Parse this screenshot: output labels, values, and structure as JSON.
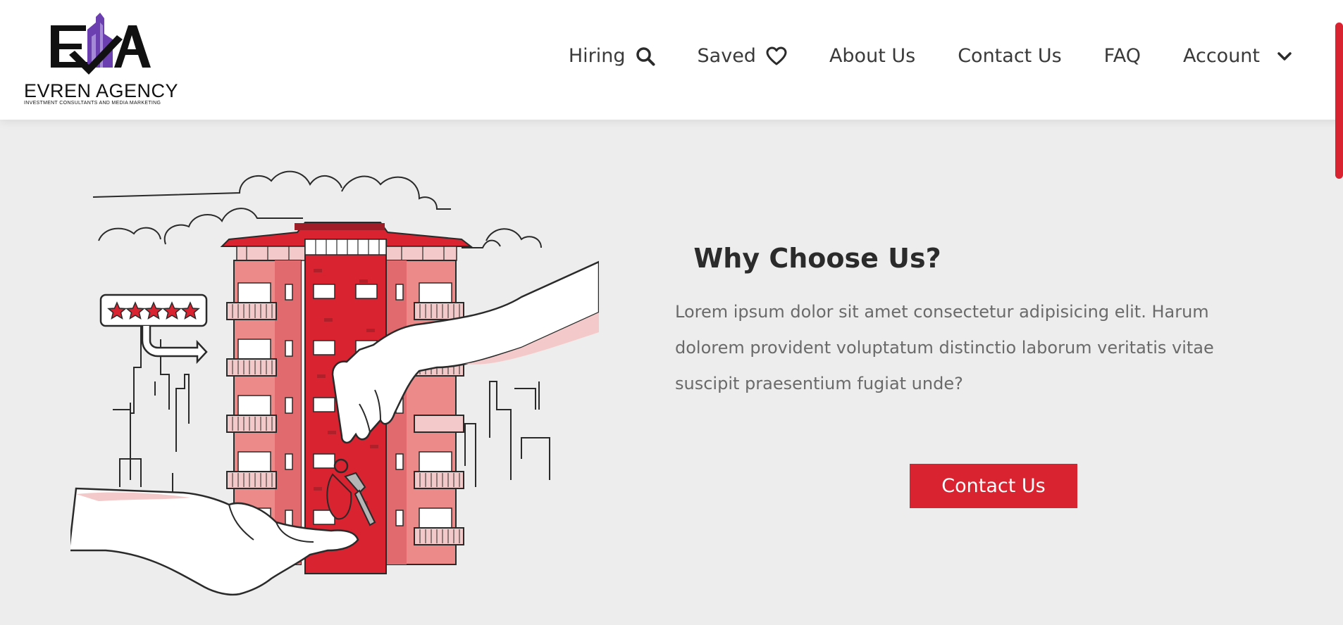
{
  "brand": {
    "name": "EVREN AGENCY",
    "tagline": "INVESTMENT CONSULTANTS AND MEDIA MARKETING",
    "monogram": "EA"
  },
  "nav": {
    "hiring": {
      "label": "Hiring",
      "icon": "search-icon"
    },
    "saved": {
      "label": "Saved",
      "icon": "heart-icon"
    },
    "about": {
      "label": "About Us"
    },
    "contact": {
      "label": "Contact Us"
    },
    "faq": {
      "label": "FAQ"
    },
    "account": {
      "label": "Account",
      "icon": "chevron-down-icon"
    }
  },
  "hero": {
    "title": "Why Choose Us?",
    "body": "Lorem ipsum dolor sit amet consectetur adipisicing elit. Harum dolorem provident voluptatum distinctio laborum veritatis vitae suscipit praesentium fugiat unde?",
    "cta_label": "Contact Us"
  },
  "rating": {
    "stars": 5,
    "max": 5
  },
  "colors": {
    "accent": "#d92331",
    "building_light": "#ec8a8a",
    "building_dark": "#9e1d26",
    "logo_purple": "#6c3fb0",
    "background": "#ededed"
  }
}
